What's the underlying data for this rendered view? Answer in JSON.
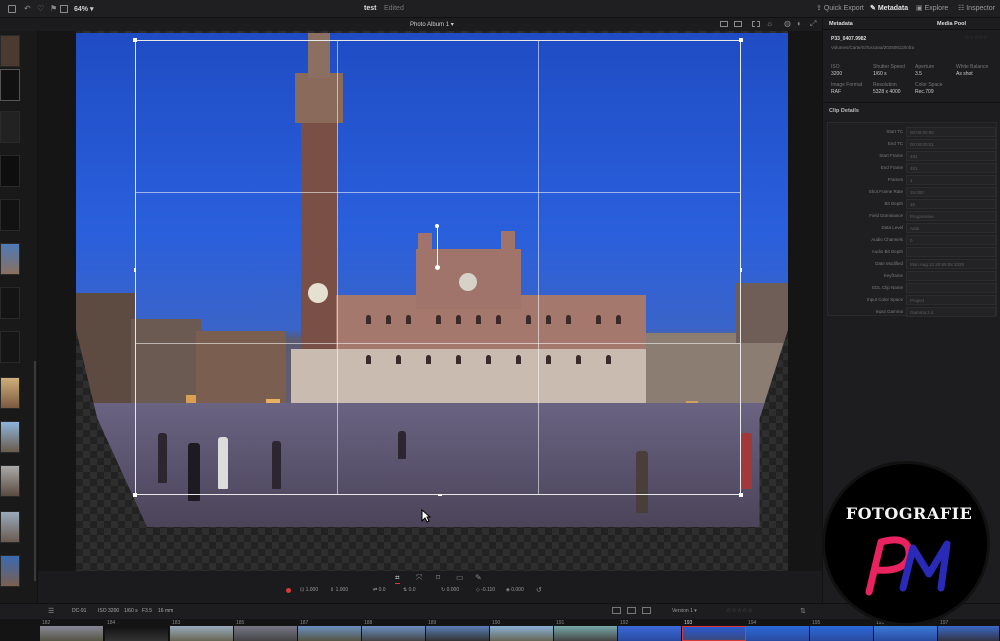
{
  "topbar": {
    "zoom": "64%",
    "project": "test",
    "edited": "Edited",
    "album": "Photo Album 1",
    "quick_export": "Quick Export",
    "metadata": "Metadata",
    "explore": "Explore",
    "inspector": "Inspector"
  },
  "right_panel": {
    "tab_metadata": "Metadata",
    "tab_media_pool": "Media Pool",
    "clip_name": "P33_0407.9982",
    "clip_path": "Volumes/Carte/SiToscana/20250812/Infra",
    "info": [
      {
        "label": "ISO",
        "value": "3200"
      },
      {
        "label": "Shutter Speed",
        "value": "1/60 s"
      },
      {
        "label": "Aperture",
        "value": "3.5"
      },
      {
        "label": "White Balance",
        "value": "As shot"
      },
      {
        "label": "Image Format",
        "value": "RAF"
      },
      {
        "label": "Resolution",
        "value": "5328 x 4000"
      },
      {
        "label": "Color Space",
        "value": "Rec.709"
      }
    ],
    "section_title": "Clip Details",
    "fields": [
      {
        "label": "Start TC",
        "value": "00:00:00:00"
      },
      {
        "label": "End TC",
        "value": "00:00:00:01"
      },
      {
        "label": "Start Frame",
        "value": "481"
      },
      {
        "label": "End Frame",
        "value": "481"
      },
      {
        "label": "Frames",
        "value": "1"
      },
      {
        "label": "Shot Frame Rate",
        "value": "25.000"
      },
      {
        "label": "Bit Depth",
        "value": "16"
      },
      {
        "label": "Field Dominance",
        "value": "Progressive"
      },
      {
        "label": "Data Level",
        "value": "Auto"
      },
      {
        "label": "Audio Channels",
        "value": "0"
      },
      {
        "label": "Audio Bit Depth",
        "value": ""
      },
      {
        "label": "Date Modified",
        "value": "Mon Aug 12 20:55:08 2025"
      },
      {
        "label": "Keyframe",
        "value": ""
      },
      {
        "label": "EDL Clip Name",
        "value": ""
      },
      {
        "label": "Input Color Space",
        "value": "Project"
      },
      {
        "label": "Input Gamma",
        "value": "Gamma 2.4"
      }
    ]
  },
  "viewer_tools": {
    "values": [
      "1.000",
      "1.000",
      "0.0",
      "0.0",
      "0.000",
      "-0.110",
      "0.000"
    ]
  },
  "clipbar": {
    "clip_info": [
      "DC-91",
      "ISO 3200",
      "1/60 s",
      "F3.5",
      "16 mm"
    ],
    "version": "Version 1"
  },
  "timeline": {
    "clips": [
      "182",
      "184",
      "183",
      "185",
      "187",
      "188",
      "189",
      "190",
      "191",
      "192",
      "193",
      "194",
      "195",
      "196",
      "197"
    ]
  },
  "watermark": {
    "text": "FOTOGRAFIE",
    "monogram": "PM"
  },
  "colors": {
    "accent_red": "#d83a3a",
    "watermark_pink": "#e8235f",
    "watermark_blue": "#2a2ab8"
  }
}
